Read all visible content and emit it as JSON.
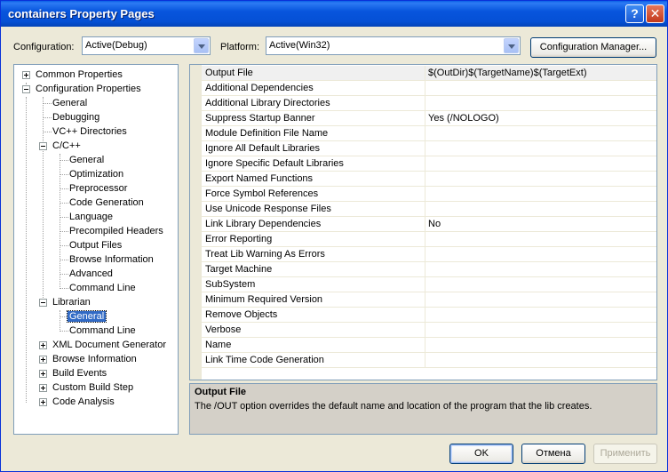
{
  "window": {
    "title": "containers Property Pages",
    "help_glyph": "?",
    "close_glyph": "✕"
  },
  "config": {
    "configuration_label": "Configuration:",
    "configuration_value": "Active(Debug)",
    "platform_label": "Platform:",
    "platform_value": "Active(Win32)",
    "manager_button": "Configuration Manager..."
  },
  "tree": {
    "items": [
      {
        "label": "Common Properties"
      },
      {
        "label": "Configuration Properties"
      },
      {
        "label": "General"
      },
      {
        "label": "Debugging"
      },
      {
        "label": "VC++ Directories"
      },
      {
        "label": "C/C++"
      },
      {
        "label": "General"
      },
      {
        "label": "Optimization"
      },
      {
        "label": "Preprocessor"
      },
      {
        "label": "Code Generation"
      },
      {
        "label": "Language"
      },
      {
        "label": "Precompiled Headers"
      },
      {
        "label": "Output Files"
      },
      {
        "label": "Browse Information"
      },
      {
        "label": "Advanced"
      },
      {
        "label": "Command Line"
      },
      {
        "label": "Librarian"
      },
      {
        "label": "General"
      },
      {
        "label": "Command Line"
      },
      {
        "label": "XML Document Generator"
      },
      {
        "label": "Browse Information"
      },
      {
        "label": "Build Events"
      },
      {
        "label": "Custom Build Step"
      },
      {
        "label": "Code Analysis"
      }
    ]
  },
  "grid": {
    "rows": [
      {
        "name": "Output File",
        "value": "$(OutDir)$(TargetName)$(TargetExt)"
      },
      {
        "name": "Additional Dependencies",
        "value": ""
      },
      {
        "name": "Additional Library Directories",
        "value": ""
      },
      {
        "name": "Suppress Startup Banner",
        "value": "Yes (/NOLOGO)"
      },
      {
        "name": "Module Definition File Name",
        "value": ""
      },
      {
        "name": "Ignore All Default Libraries",
        "value": ""
      },
      {
        "name": "Ignore Specific Default Libraries",
        "value": ""
      },
      {
        "name": "Export Named Functions",
        "value": ""
      },
      {
        "name": "Force Symbol References",
        "value": ""
      },
      {
        "name": "Use Unicode Response Files",
        "value": ""
      },
      {
        "name": "Link Library Dependencies",
        "value": "No"
      },
      {
        "name": "Error Reporting",
        "value": ""
      },
      {
        "name": "Treat Lib Warning As Errors",
        "value": ""
      },
      {
        "name": "Target Machine",
        "value": ""
      },
      {
        "name": "SubSystem",
        "value": ""
      },
      {
        "name": "Minimum Required Version",
        "value": ""
      },
      {
        "name": "Remove Objects",
        "value": ""
      },
      {
        "name": "Verbose",
        "value": ""
      },
      {
        "name": "Name",
        "value": ""
      },
      {
        "name": "Link Time Code Generation",
        "value": ""
      }
    ]
  },
  "description": {
    "title": "Output File",
    "text": "The /OUT option overrides the default name and location of the program that the lib creates."
  },
  "buttons": {
    "ok": "OK",
    "cancel": "Отмена",
    "apply": "Применить"
  }
}
